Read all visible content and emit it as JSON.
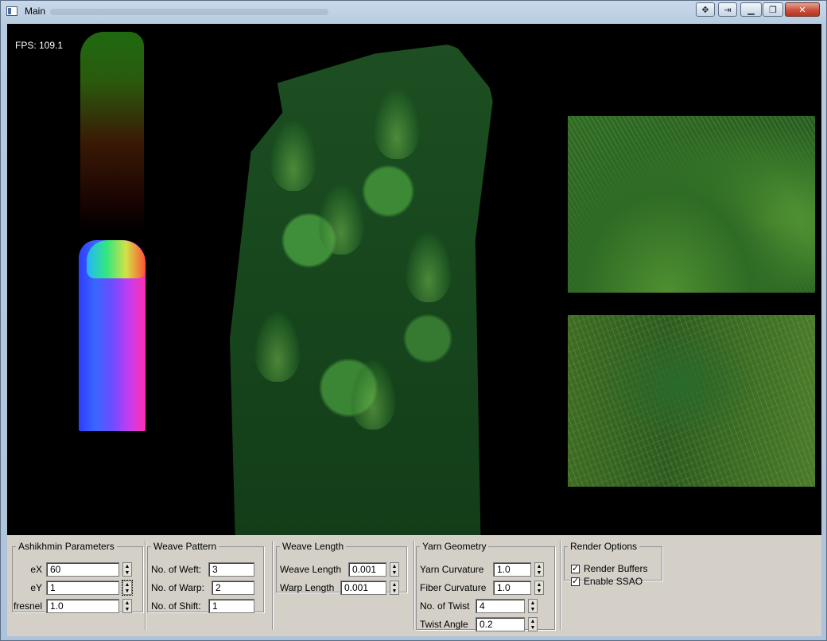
{
  "window": {
    "title": "Main"
  },
  "viewport": {
    "fps_label": "FPS: 109.1"
  },
  "panel": {
    "ashikhmin": {
      "legend": "Ashikhmin Parameters",
      "ex_label": "eX",
      "ex_value": "60",
      "ey_label": "eY",
      "ey_value": "1",
      "fresnel_label": "fresnel",
      "fresnel_value": "1.0"
    },
    "weave_pattern": {
      "legend": "Weave Pattern",
      "weft_label": "No. of Weft:",
      "weft_value": "3",
      "warp_label": "No. of Warp:",
      "warp_value": "2",
      "shift_label": "No. of Shift:",
      "shift_value": "1"
    },
    "weave_length": {
      "legend": "Weave Length",
      "weave_label": "Weave Length",
      "weave_value": "0.001",
      "warp_label": "Warp Length",
      "warp_value": "0.001"
    },
    "yarn_geometry": {
      "legend": "Yarn Geometry",
      "yarn_curv_label": "Yarn Curvature",
      "yarn_curv_value": "1.0",
      "fiber_curv_label": "Fiber Curvature",
      "fiber_curv_value": "1.0",
      "twist_label": "No. of Twist",
      "twist_value": "4",
      "twist_angle_label": "Twist Angle",
      "twist_angle_value": "0.2"
    },
    "render_options": {
      "legend": "Render Options",
      "render_buffers_label": "Render Buffers",
      "render_buffers_checked": true,
      "ssao_label": "Enable SSAO",
      "ssao_checked": true
    }
  }
}
